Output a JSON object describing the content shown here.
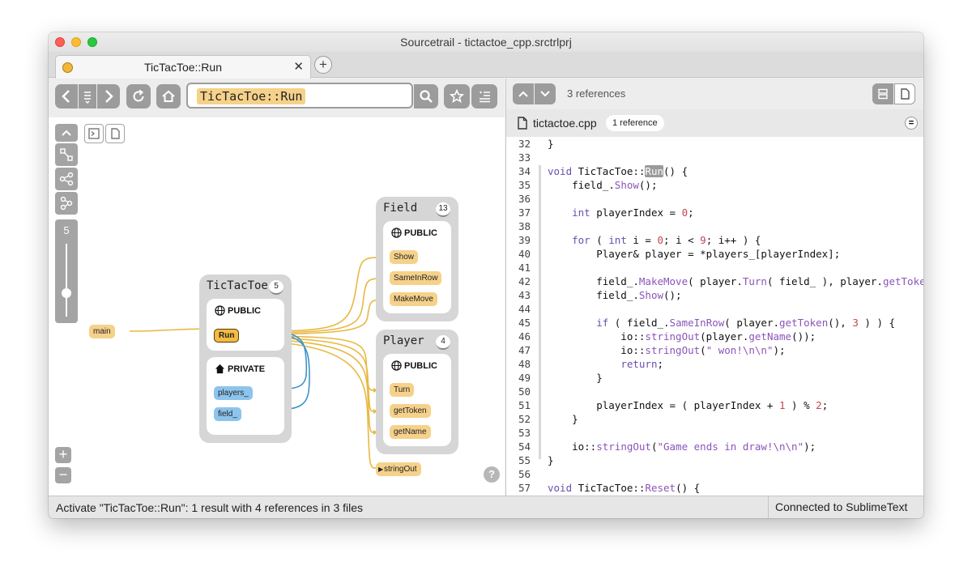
{
  "window": {
    "title": "Sourcetrail - tictactoe_cpp.srctrlprj"
  },
  "tabs": [
    {
      "title": "TicTacToe::Run"
    }
  ],
  "search": {
    "query": "TicTacToe::Run"
  },
  "graph": {
    "depth_level": "5",
    "nodes": {
      "tictactoe": {
        "name": "TicTacToe",
        "count": "5",
        "public_label": "PUBLIC",
        "private_label": "PRIVATE",
        "public_members": [
          "Run"
        ],
        "private_members": [
          "players_",
          "field_"
        ]
      },
      "field": {
        "name": "Field",
        "count": "13",
        "public_label": "PUBLIC",
        "public_members": [
          "Show",
          "SameInRow",
          "MakeMove"
        ]
      },
      "player": {
        "name": "Player",
        "count": "4",
        "public_label": "PUBLIC",
        "public_members": [
          "Turn",
          "getToken",
          "getName"
        ]
      },
      "main": "main",
      "stringout": "stringOut"
    },
    "colors": {
      "function": "#f6d18a",
      "active": "#f3bb43",
      "variable": "#8dc4ec",
      "call_edge": "#e8b842",
      "access_edge": "#3f93c6"
    }
  },
  "code": {
    "reference_count": "3 references",
    "file": {
      "name": "tictactoe.cpp",
      "badge": "1 reference"
    },
    "lines": [
      {
        "n": "32",
        "text": "}"
      },
      {
        "n": "33",
        "text": ""
      },
      {
        "n": "34",
        "text": "void TicTacToe::Run() {"
      },
      {
        "n": "35",
        "text": "    field_.Show();"
      },
      {
        "n": "36",
        "text": ""
      },
      {
        "n": "37",
        "text": "    int playerIndex = 0;"
      },
      {
        "n": "38",
        "text": ""
      },
      {
        "n": "39",
        "text": "    for ( int i = 0; i < 9; i++ ) {"
      },
      {
        "n": "40",
        "text": "        Player& player = *players_[playerIndex];"
      },
      {
        "n": "41",
        "text": ""
      },
      {
        "n": "42",
        "text": "        field_.MakeMove( player.Turn( field_ ), player.getToke"
      },
      {
        "n": "43",
        "text": "        field_.Show();"
      },
      {
        "n": "44",
        "text": ""
      },
      {
        "n": "45",
        "text": "        if ( field_.SameInRow( player.getToken(), 3 ) ) {"
      },
      {
        "n": "46",
        "text": "            io::stringOut(player.getName());"
      },
      {
        "n": "47",
        "text": "            io::stringOut(\" won!\\n\\n\");"
      },
      {
        "n": "48",
        "text": "            return;"
      },
      {
        "n": "49",
        "text": "        }"
      },
      {
        "n": "50",
        "text": ""
      },
      {
        "n": "51",
        "text": "        playerIndex = ( playerIndex + 1 ) % 2;"
      },
      {
        "n": "52",
        "text": "    }"
      },
      {
        "n": "53",
        "text": ""
      },
      {
        "n": "54",
        "text": "    io::stringOut(\"Game ends in draw!\\n\\n\");"
      },
      {
        "n": "55",
        "text": "}"
      },
      {
        "n": "56",
        "text": ""
      },
      {
        "n": "57",
        "text": "void TicTacToe::Reset() {"
      }
    ]
  },
  "status": {
    "left": "Activate \"TicTacToe::Run\": 1 result with 4 references in 3 files",
    "right": "Connected to SublimeText"
  }
}
